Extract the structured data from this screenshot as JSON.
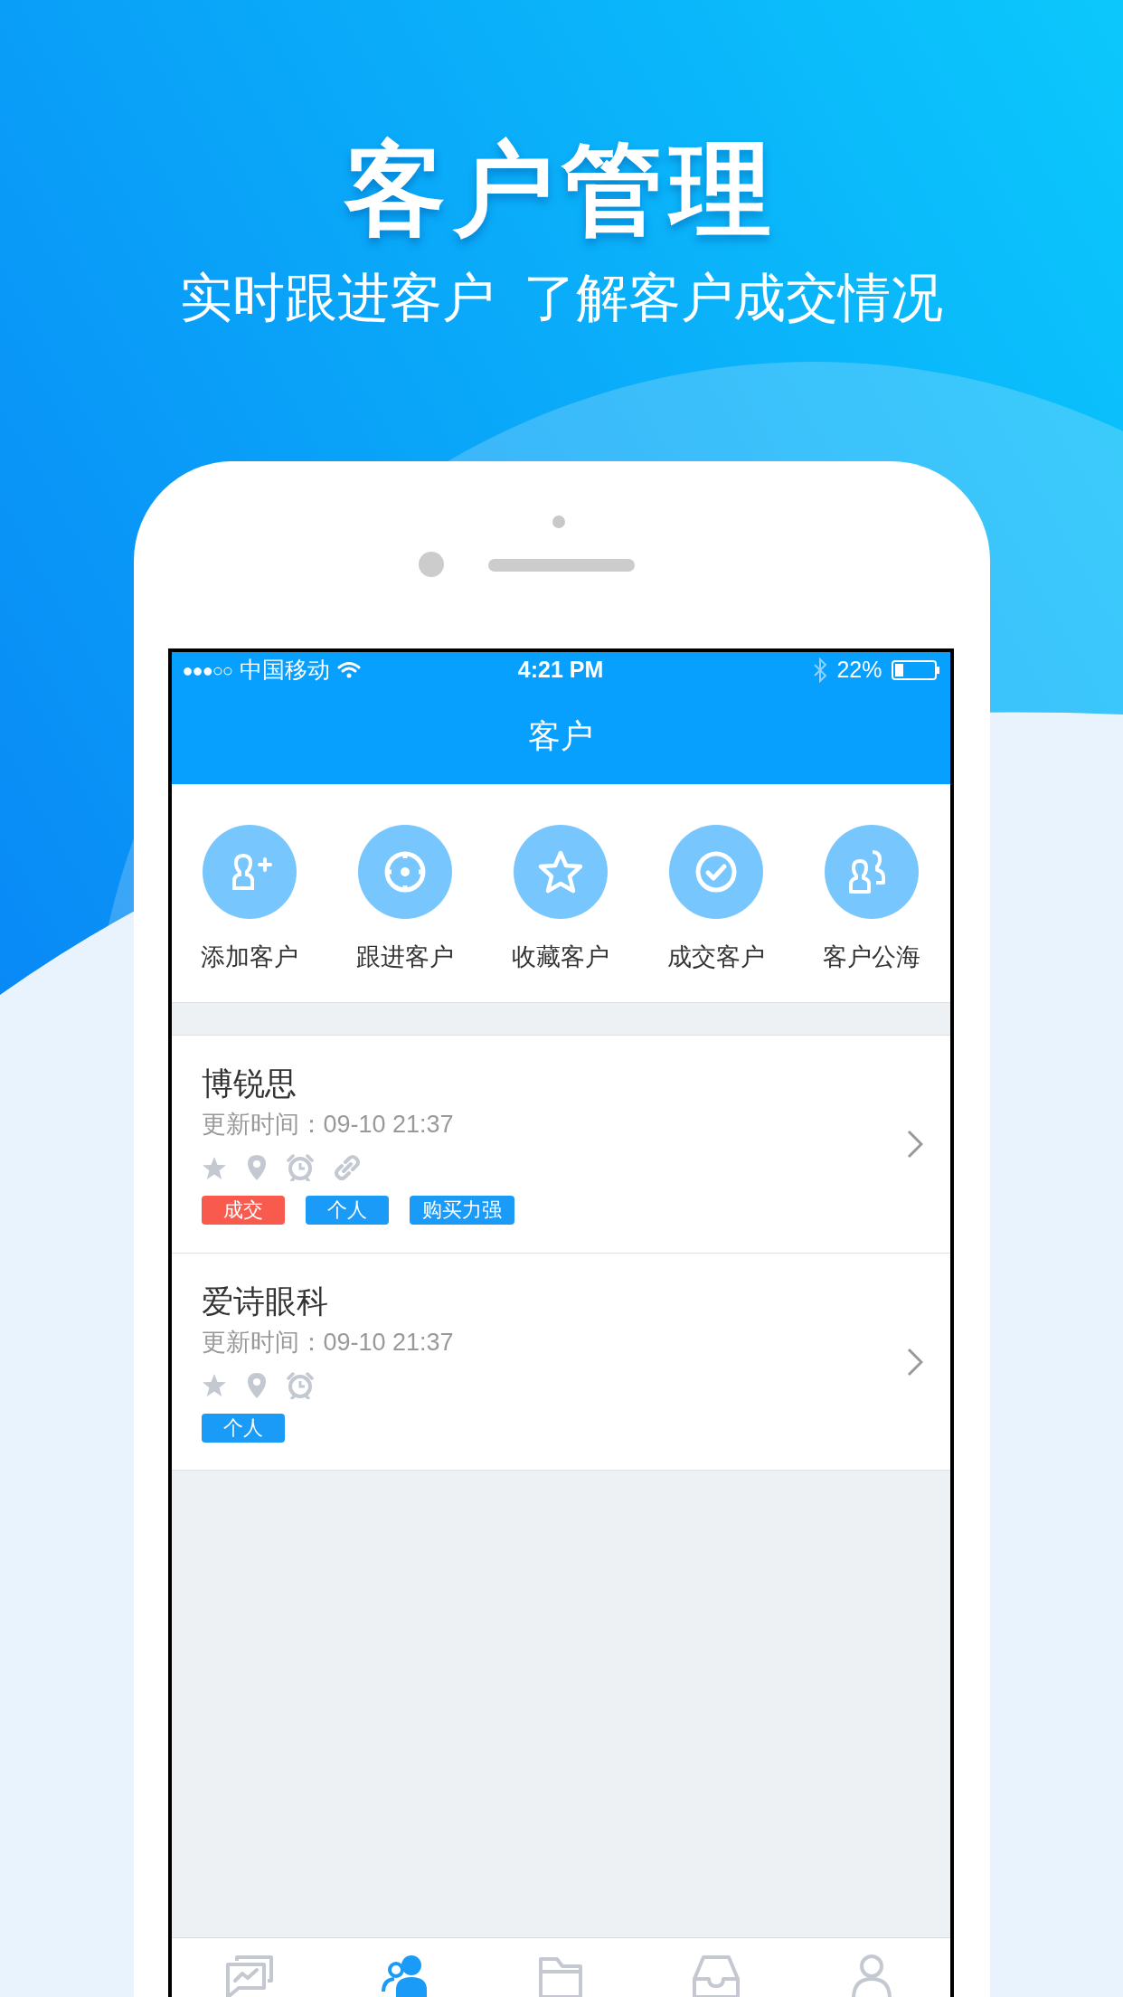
{
  "headline": "客户管理",
  "subtitle": "实时跟进客户  了解客户成交情况",
  "status_bar": {
    "signal": "●●●○○",
    "carrier": "中国移动",
    "time": "4:21 PM",
    "battery": "22%"
  },
  "nav_bar": {
    "title": "客户"
  },
  "shortcuts": [
    {
      "kind": "add-person",
      "label": "添加客户"
    },
    {
      "kind": "target",
      "label": "跟进客户"
    },
    {
      "kind": "star",
      "label": "收藏客户"
    },
    {
      "kind": "check",
      "label": "成交客户"
    },
    {
      "kind": "people",
      "label": "客户公海"
    }
  ],
  "customers": [
    {
      "name": "博锐思",
      "updated": "更新时间：09-10 21:37",
      "icons": [
        {
          "kind": "star"
        },
        {
          "kind": "location"
        },
        {
          "kind": "alarm"
        },
        {
          "kind": "link"
        }
      ],
      "tags": [
        {
          "label": "成交",
          "color": "#f85a4e"
        },
        {
          "label": "个人",
          "color": "#1a9bf8"
        },
        {
          "label": "购买力强",
          "color": "#1a9bf8"
        }
      ]
    },
    {
      "name": "爱诗眼科",
      "updated": "更新时间：09-10 21:37",
      "icons": [
        {
          "kind": "star"
        },
        {
          "kind": "location"
        },
        {
          "kind": "alarm"
        }
      ],
      "tags": [
        {
          "label": "个人",
          "color": "#1a9bf8"
        }
      ]
    }
  ],
  "tab_bar": [
    {
      "kind": "chat",
      "selected": false
    },
    {
      "kind": "customers",
      "selected": true
    },
    {
      "kind": "folder",
      "selected": false
    },
    {
      "kind": "inbox",
      "selected": false
    },
    {
      "kind": "profile",
      "selected": false
    }
  ]
}
